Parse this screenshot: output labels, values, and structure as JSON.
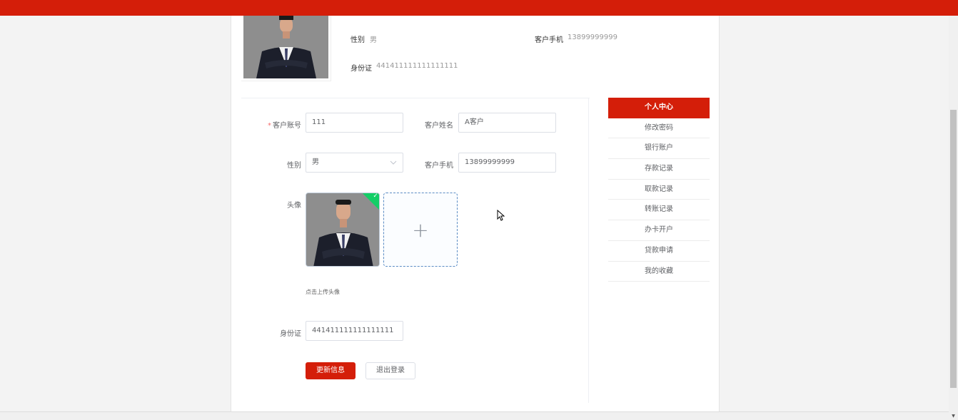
{
  "summary": {
    "gender_label": "性别",
    "gender_value": "男",
    "phone_label": "客户手机",
    "phone_value": "13899999999",
    "id_label": "身份证",
    "id_value": "441411111111111111"
  },
  "form": {
    "account_label": "客户账号",
    "account_required": "*",
    "account_value": "111",
    "name_label": "客户姓名",
    "name_value": "A客户",
    "gender_label": "性别",
    "gender_value": "男",
    "phone_label": "客户手机",
    "phone_value": "13899999999",
    "avatar_label": "头像",
    "avatar_tip": "点击上传头像",
    "id_label": "身份证",
    "id_value": "441411111111111111",
    "update_button": "更新信息",
    "logout_button": "退出登录"
  },
  "sidebar": {
    "items": [
      {
        "label": "个人中心"
      },
      {
        "label": "修改密码"
      },
      {
        "label": "银行账户"
      },
      {
        "label": "存款记录"
      },
      {
        "label": "取款记录"
      },
      {
        "label": "转账记录"
      },
      {
        "label": "办卡开户"
      },
      {
        "label": "贷款申请"
      },
      {
        "label": "我的收藏"
      }
    ],
    "active_index": 0
  },
  "colors": {
    "brand": "#d41e09",
    "success": "#13ce66",
    "upload_border": "#5b8cc4"
  },
  "icons": {
    "chevron": "chevron-down-icon",
    "plus": "plus-icon",
    "check": "check-icon",
    "cursor": "mouse-cursor-icon"
  }
}
